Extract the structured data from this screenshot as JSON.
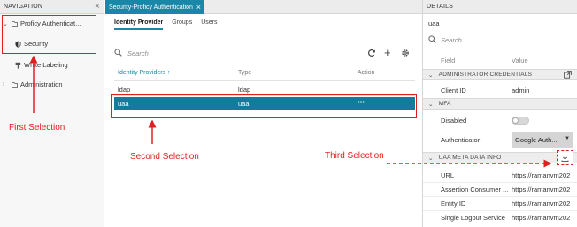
{
  "navigation": {
    "header": "NAVIGATION",
    "items": [
      {
        "label": "Proficy Authenticat...",
        "expanded": true
      },
      {
        "label": "Security"
      },
      {
        "label": "White Labeling"
      },
      {
        "label": "Administration",
        "expanded": false
      }
    ]
  },
  "main": {
    "doc_tab": "Security-Proficy Authentication",
    "subtabs": [
      "Identity Provider",
      "Groups",
      "Users"
    ],
    "search_placeholder": "Search",
    "table": {
      "columns": [
        "Identity Providers",
        "Type",
        "Action"
      ],
      "sort_indicator": "↑",
      "rows": [
        {
          "name": "ldap",
          "type": "ldap",
          "action": ""
        },
        {
          "name": "uaa",
          "type": "uaa",
          "action": "•••",
          "selected": true
        }
      ]
    }
  },
  "details": {
    "header": "DETAILS",
    "title": "uaa",
    "search_placeholder": "Search",
    "columns": [
      "Field",
      "Value"
    ],
    "sections": [
      {
        "title": "ADMINISTRATOR CREDENTIALS",
        "fields": [
          {
            "field": "Client ID",
            "value": "admin"
          }
        ]
      },
      {
        "title": "MFA",
        "fields": [
          {
            "field": "Disabled",
            "value": ""
          },
          {
            "field": "Authenticator",
            "value": "Google Auth..."
          }
        ]
      },
      {
        "title": "UAA META DATA INFO",
        "fields": [
          {
            "field": "URL",
            "value": "https://ramanvm202"
          },
          {
            "field": "Assertion Consumer ...",
            "value": "https://ramanvm202"
          },
          {
            "field": "Entity ID",
            "value": "https://ramanvm202"
          },
          {
            "field": "Single Logout Service",
            "value": "https://ramanvm202"
          }
        ]
      }
    ]
  },
  "annotations": {
    "first": "First Selection",
    "second": "Second Selection",
    "third": "Third Selection"
  },
  "colors": {
    "accent": "#1a86a8",
    "selected_row": "#137c9b",
    "annotation": "#e02020"
  }
}
